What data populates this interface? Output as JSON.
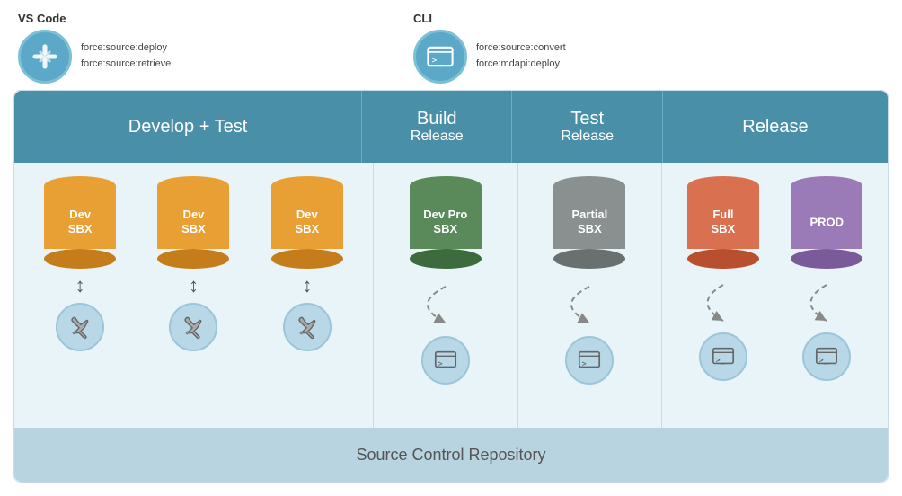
{
  "top": {
    "vscode_label": "VS Code",
    "vscode_cmd1": "force:source:deploy",
    "vscode_cmd2": "force:source:retrieve",
    "cli_label": "CLI",
    "cli_cmd1": "force:source:convert",
    "cli_cmd2": "force:mdapi:deploy"
  },
  "headers": {
    "develop": {
      "line1": "Develop + Test",
      "line2": ""
    },
    "build": {
      "line1": "Build",
      "line2": "Release"
    },
    "test": {
      "line1": "Test",
      "line2": "Release"
    },
    "release": {
      "line1": "Release",
      "line2": ""
    }
  },
  "cylinders": {
    "dev1": {
      "line1": "Dev",
      "line2": "SBX",
      "color": "orange"
    },
    "dev2": {
      "line1": "Dev",
      "line2": "SBX",
      "color": "orange"
    },
    "dev3": {
      "line1": "Dev",
      "line2": "SBX",
      "color": "orange"
    },
    "devpro": {
      "line1": "Dev Pro",
      "line2": "SBX",
      "color": "green"
    },
    "partial": {
      "line1": "Partial",
      "line2": "SBX",
      "color": "gray"
    },
    "fullsbx": {
      "line1": "Full",
      "line2": "SBX",
      "color": "coral"
    },
    "prod": {
      "line1": "PROD",
      "line2": "",
      "color": "purple"
    }
  },
  "source_control": "Source Control Repository"
}
